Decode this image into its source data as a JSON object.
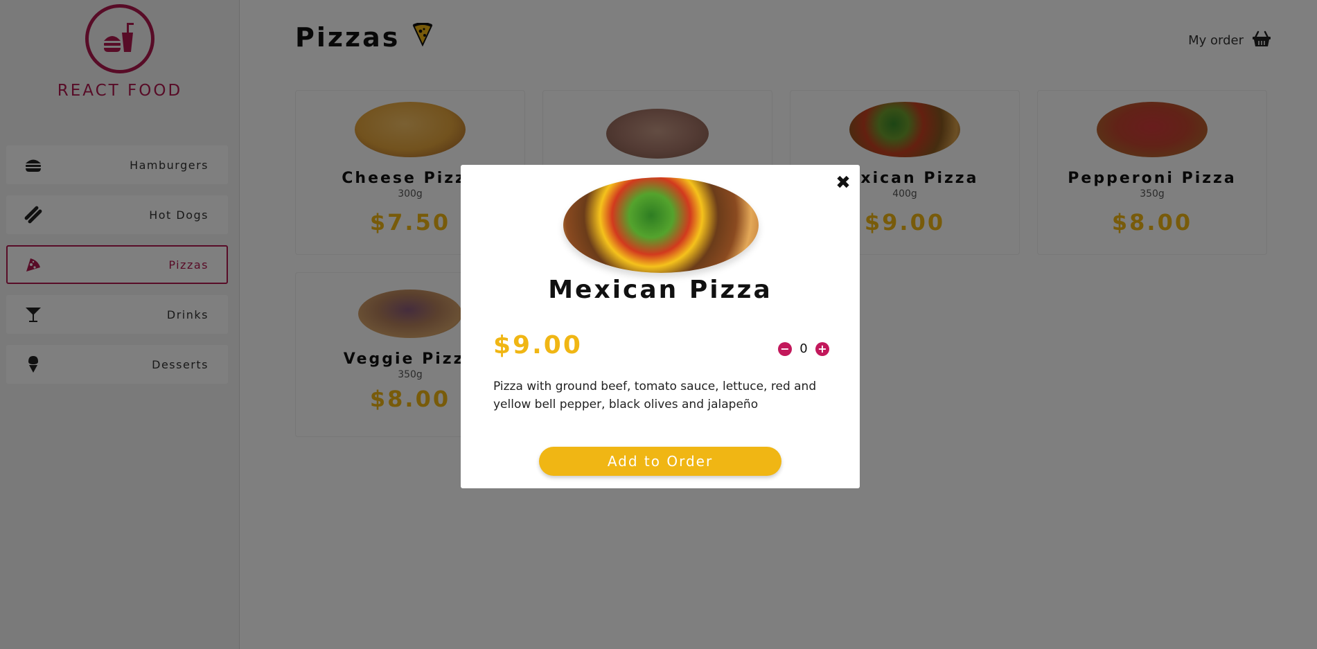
{
  "brand": {
    "name": "REACT FOOD",
    "color": "#b0194f"
  },
  "sidebar": {
    "items": [
      {
        "label": "Hamburgers",
        "icon": "hamburger-icon",
        "active": false
      },
      {
        "label": "Hot Dogs",
        "icon": "hotdog-icon",
        "active": false
      },
      {
        "label": "Pizzas",
        "icon": "pizza-icon",
        "active": true
      },
      {
        "label": "Drinks",
        "icon": "cocktail-icon",
        "active": false
      },
      {
        "label": "Desserts",
        "icon": "ice-cream-icon",
        "active": false
      }
    ]
  },
  "header": {
    "title": "Pizzas",
    "title_icon": "pizza-slice-icon",
    "my_order_label": "My order",
    "cart_icon": "basket-icon"
  },
  "products": [
    {
      "name": "Cheese Pizza",
      "weight": "300g",
      "price": "$7.50"
    },
    {
      "name": "",
      "weight": "",
      "price": ""
    },
    {
      "name": "Mexican Pizza",
      "weight": "400g",
      "price": "$9.00"
    },
    {
      "name": "Pepperoni Pizza",
      "weight": "350g",
      "price": "$8.00"
    },
    {
      "name": "Veggie Pizza",
      "weight": "350g",
      "price": "$8.00"
    }
  ],
  "modal": {
    "title": "Mexican Pizza",
    "price": "$9.00",
    "quantity": "0",
    "description": "Pizza with ground beef, tomato sauce, lettuce, red and yellow bell pepper, black olives and jalapeño",
    "add_button_label": "Add to Order",
    "close_icon": "close-icon"
  },
  "colors": {
    "accent": "#f0b614",
    "brand": "#b0194f",
    "stepper": "#c2185b"
  }
}
